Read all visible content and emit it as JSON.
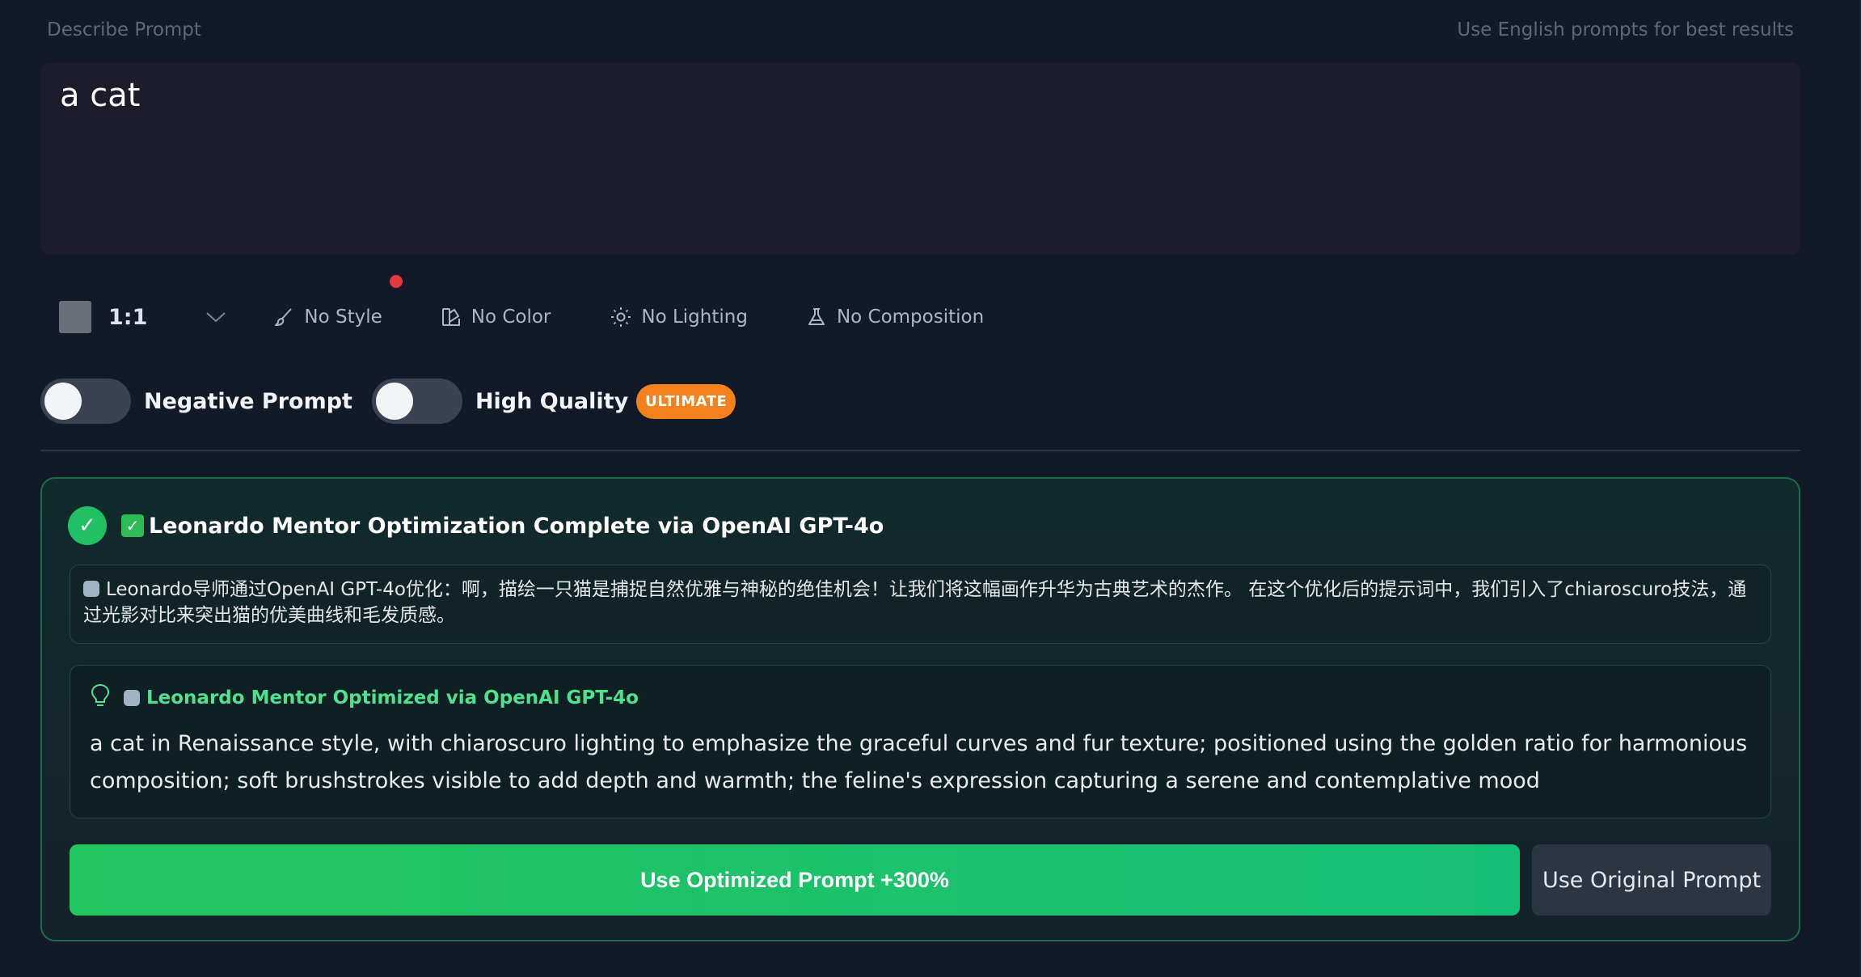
{
  "header": {
    "label": "Describe Prompt",
    "hint": "Use English prompts for best results"
  },
  "prompt": {
    "value": "a cat"
  },
  "options": {
    "ratio": "1:1",
    "style": "No Style",
    "color": "No Color",
    "lighting": "No Lighting",
    "composition": "No Composition"
  },
  "toggles": {
    "negative_prompt": "Negative Prompt",
    "negative_prompt_on": false,
    "high_quality": "High Quality",
    "high_quality_on": false,
    "badge": "ULTIMATE"
  },
  "result": {
    "title_check": "✓",
    "title_emoji": "✓",
    "title": "Leonardo Mentor Optimization Complete via OpenAI GPT-4o",
    "explanation": "Leonardo导师通过OpenAI GPT-4o优化：啊，描绘一只猫是捕捉自然优雅与神秘的绝佳机会！让我们将这幅画作升华为古典艺术的杰作。 在这个优化后的提示词中，我们引入了chiaroscuro技法，通过光影对比来突出猫的优美曲线和毛发质感。",
    "optimized_header": "Leonardo Mentor Optimized via OpenAI GPT-4o",
    "optimized_prompt": "a cat in Renaissance style, with chiaroscuro lighting to emphasize the graceful curves and fur texture; positioned using the golden ratio for harmonious composition; soft brushstrokes visible to add depth and warmth; the feline's expression capturing a serene and contemplative mood",
    "use_optimized": "Use Optimized Prompt +300%",
    "use_original": "Use Original Prompt"
  },
  "colors": {
    "background": "#121a28",
    "accent_green": "#22c55e",
    "badge_orange": "#f3821d",
    "notification_red": "#e5393f"
  }
}
